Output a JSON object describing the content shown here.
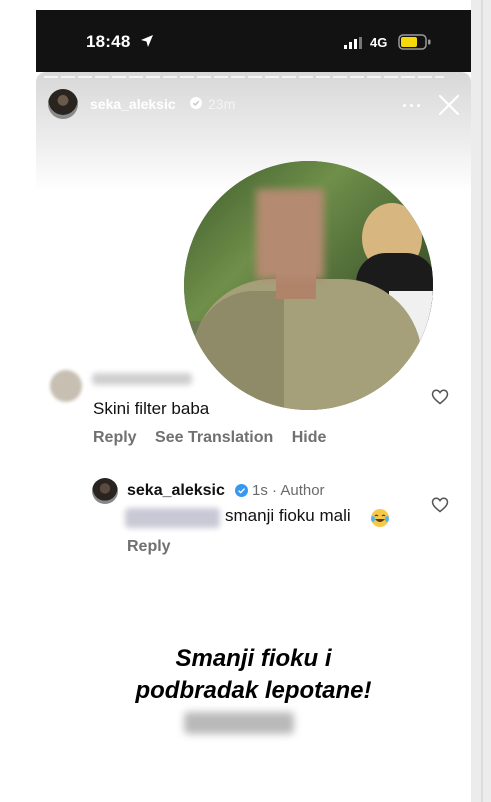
{
  "status_bar": {
    "time": "18:48",
    "network": "4G"
  },
  "story": {
    "username": "seka_aleksic",
    "time_ago": "23m",
    "more": "···"
  },
  "comment": {
    "text": "Skini filter baba",
    "actions": [
      "Reply",
      "See Translation",
      "Hide"
    ]
  },
  "reply": {
    "username": "seka_aleksic",
    "meta": "1s · Author",
    "text": "smanji fioku mali",
    "action": "Reply"
  },
  "caption": {
    "line1": "Smanji fioku i",
    "line2": "podbradak lepotane!"
  },
  "colors": {
    "status_bar_bg": "#121212",
    "verified_blue": "#3897f0",
    "battery_yellow": "#f5d90a",
    "secondary_text": "#707070"
  }
}
